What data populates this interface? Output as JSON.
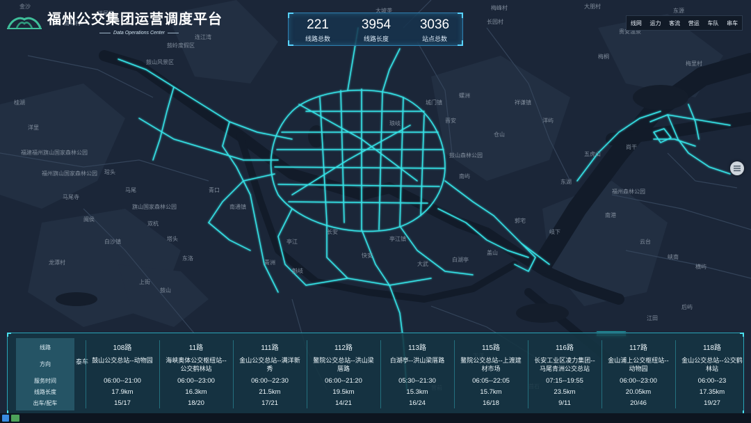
{
  "header": {
    "title": "福州公交集团运营调度平台",
    "subtitle": "Data Operations Center"
  },
  "stats": [
    {
      "value": "221",
      "label": "线路总数"
    },
    {
      "value": "3954",
      "label": "线路长度"
    },
    {
      "value": "3036",
      "label": "站点总数"
    }
  ],
  "menu": [
    "线网",
    "运力",
    "客流",
    "营运",
    "车队",
    "串车"
  ],
  "table": {
    "row_headers": [
      "线路",
      "方向",
      "服务时间",
      "线路长度",
      "出车/配车"
    ],
    "partial_left_label": "泰车",
    "routes": [
      {
        "name": "108路",
        "direction": "鼓山公交总站--动物园",
        "time": "06:00--21:00",
        "length": "17.9km",
        "bus": "15/17"
      },
      {
        "name": "11路",
        "direction": "海峡奥体公交枢纽站--公交鹤林站",
        "time": "06:00--23:00",
        "length": "16.3km",
        "bus": "18/20"
      },
      {
        "name": "111路",
        "direction": "金山公交总站--满洋新秀",
        "time": "06:00--22:30",
        "length": "21.5km",
        "bus": "17/21"
      },
      {
        "name": "112路",
        "direction": "鳌院公交总站--洪山梁厝路",
        "time": "06:00--21:20",
        "length": "19.5km",
        "bus": "14/21"
      },
      {
        "name": "113路",
        "direction": "白湖亭--洪山梁厝路",
        "time": "05:30--21:30",
        "length": "15.3km",
        "bus": "16/24"
      },
      {
        "name": "115路",
        "direction": "鳌院公交总站--上渡建材市场",
        "time": "06:05--22:05",
        "length": "15.7km",
        "bus": "16/18"
      },
      {
        "name": "116路",
        "direction": "长安工业区凌力集团--马尾青洲公交总站",
        "time": "07:15--19:55",
        "length": "23.5km",
        "bus": "9/11"
      },
      {
        "name": "117路",
        "direction": "金山浦上公交枢纽站--动物园",
        "time": "06:00--23:00",
        "length": "20.05km",
        "bus": "20/46"
      },
      {
        "name": "118路",
        "direction": "金山公交总站--公交鹤林站",
        "time": "06:00--23",
        "length": "17.35km",
        "bus": "19/27"
      }
    ]
  },
  "map_labels": [
    "金沙",
    "洋尾洋",
    "大坡垄",
    "梅峰村",
    "大朋村",
    "东源",
    "南马村",
    "长园村",
    "连江湾",
    "贵安温泉",
    "梅桐",
    "梅里村",
    "桂湖",
    "洋里",
    "福建福州旗山国家森林公园",
    "福州旗山国家森林公园",
    "马尾寺",
    "闽侯",
    "白沙镇",
    "龙潭村",
    "上街",
    "鼓山",
    "鼓山风景区",
    "鼓岭度假区",
    "晋安",
    "仓山",
    "鼓山森林公园",
    "南屿",
    "东湖",
    "福州森林公园",
    "琅岐",
    "长安",
    "亭江",
    "琯头",
    "马尾",
    "旗山国家森林公园",
    "双杭",
    "塔头",
    "东洛",
    "青口",
    "南通镇",
    "城门镇",
    "螺洲",
    "祥谦镇",
    "洋屿",
    "五虎山",
    "尚干",
    "青洲",
    "魁岐",
    "快安",
    "亭江镇",
    "大武",
    "白湖亭",
    "盖山",
    "郭宅",
    "岐下",
    "南港",
    "云台",
    "峡南",
    "横屿",
    "后屿",
    "江田",
    "潭头",
    "首石",
    "下洋",
    "营前"
  ]
}
